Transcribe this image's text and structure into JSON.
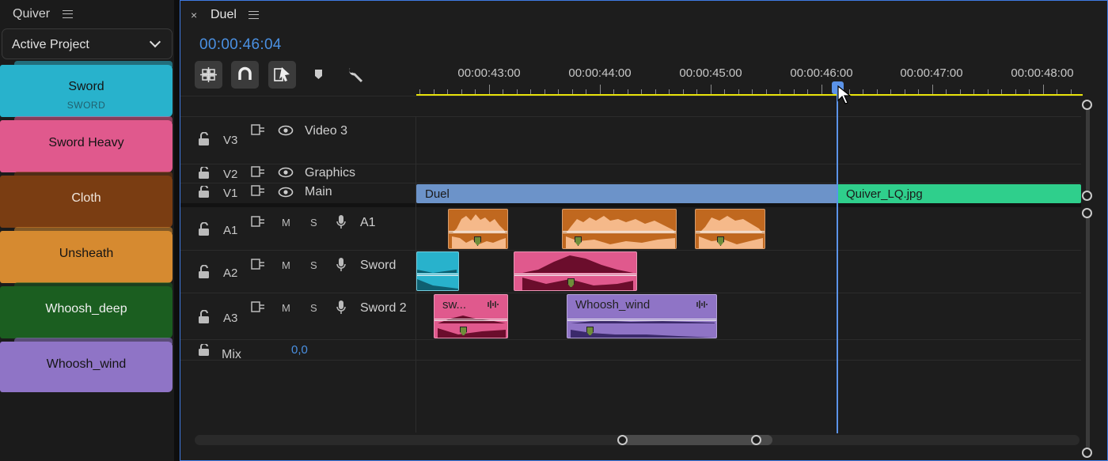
{
  "project_panel": {
    "title": "Quiver",
    "dropdown": "Active Project",
    "bins": [
      {
        "label": "Sword",
        "sub": "SWORD",
        "color": "#28b2cc"
      },
      {
        "label": "Sword Heavy",
        "sub": "",
        "color": "#e0598d"
      },
      {
        "label": "Cloth",
        "sub": "",
        "color": "#7a3d12"
      },
      {
        "label": "Unsheath",
        "sub": "",
        "color": "#d68a30"
      },
      {
        "label": "Whoosh_deep",
        "sub": "",
        "color": "#1b5e20"
      },
      {
        "label": "Whoosh_wind",
        "sub": "",
        "color": "#8f74c6"
      }
    ]
  },
  "timeline": {
    "tab_close": "×",
    "tab_title": "Duel",
    "timecode": "00:00:46:04",
    "tools": [
      "insert-nest-icon",
      "snap-magnet-icon",
      "linked-selection-icon",
      "add-marker-icon",
      "settings-wrench-icon"
    ],
    "ruler_labels": [
      "00:00:43:00",
      "00:00:44:00",
      "00:00:45:00",
      "00:00:46:00",
      "00:00:47:00",
      "00:00:48:00"
    ],
    "video_tracks": [
      {
        "id": "V3",
        "name": "Video 3"
      },
      {
        "id": "V2",
        "name": "Graphics"
      },
      {
        "id": "V1",
        "name": "Main"
      }
    ],
    "audio_tracks": [
      {
        "id": "A1",
        "name": "A1",
        "m": "M",
        "s": "S"
      },
      {
        "id": "A2",
        "name": "Sword",
        "m": "M",
        "s": "S"
      },
      {
        "id": "A3",
        "name": "Sword 2",
        "m": "M",
        "s": "S"
      }
    ],
    "mix": {
      "label": "Mix",
      "value": "0,0"
    },
    "video_clips": [
      {
        "name": "Duel",
        "color": "#6c93c9"
      },
      {
        "name": "Quiver_LQ.jpg",
        "color": "#2fcf8c"
      }
    ],
    "audio_clips": [
      {
        "name": "sw...",
        "color": "#e0598d"
      },
      {
        "name": "Whoosh_wind",
        "color": "#8f74c6"
      }
    ],
    "accent_color": "#4a90e2",
    "work_area_color": "#e8e20a"
  }
}
